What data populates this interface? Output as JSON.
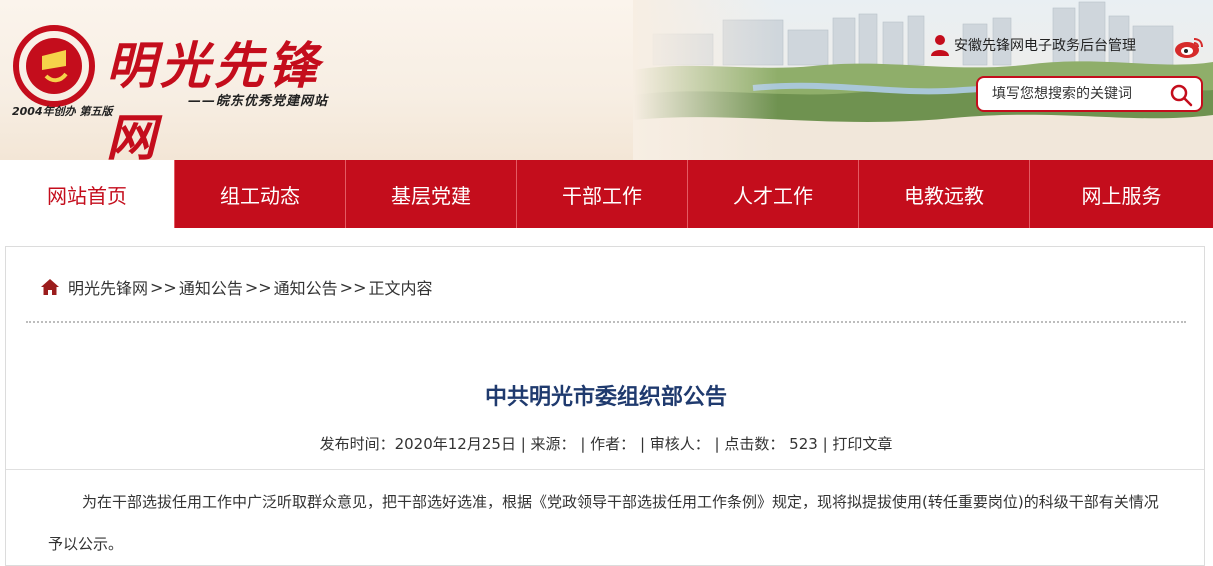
{
  "header": {
    "site_title": "明光先锋网",
    "slogan": "——皖东优秀党建网站",
    "edition": "2004年创办 第五版",
    "admin_link": "安徽先锋网电子政务后台管理",
    "search": {
      "placeholder": "填写您想搜索的关键词"
    }
  },
  "nav": {
    "items": [
      {
        "label": "网站首页",
        "active": true
      },
      {
        "label": "组工动态"
      },
      {
        "label": "基层党建"
      },
      {
        "label": "干部工作"
      },
      {
        "label": "人才工作"
      },
      {
        "label": "电教远教"
      },
      {
        "label": "网上服务"
      }
    ]
  },
  "breadcrumb": {
    "items": [
      "明光先锋网",
      "通知公告",
      "通知公告",
      "正文内容"
    ],
    "separator": ">>"
  },
  "article": {
    "title": "中共明光市委组织部公告",
    "meta": {
      "publish_label": "发布时间：",
      "publish_date": "2020年12月25日",
      "source_label": "来源：",
      "author_label": "作者：",
      "reviewer_label": "审核人：",
      "clicks_label": "点击数：",
      "clicks": "523",
      "print_label": "打印文章"
    },
    "body": "为在干部选拔任用工作中广泛听取群众意见，把干部选好选准，根据《党政领导干部选拔任用工作条例》规定，现将拟提拔使用(转任重要岗位)的科级干部有关情况予以公示。"
  },
  "colors": {
    "brand_red": "#c40d1c",
    "title_blue": "#1f3a6e"
  },
  "icons": [
    "party-emblem-icon",
    "user-icon",
    "weibo-icon",
    "search-icon",
    "home-icon"
  ]
}
